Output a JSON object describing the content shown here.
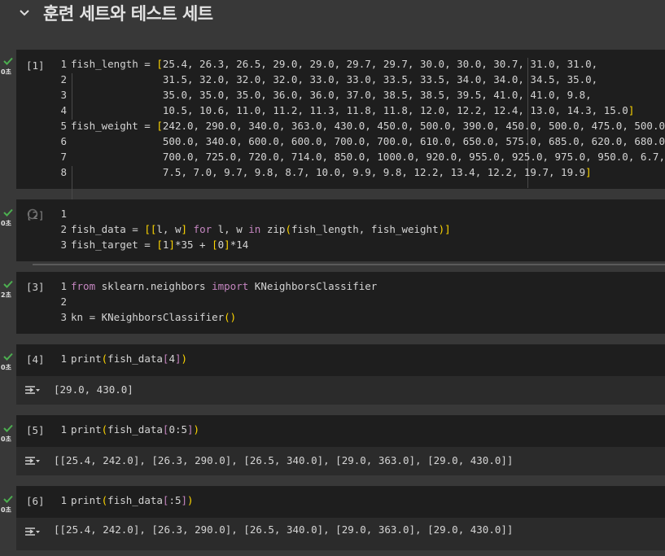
{
  "section": {
    "title": "훈련 세트와 테스트 세트"
  },
  "cells": [
    {
      "exec": "[1]",
      "time": "0초",
      "lines": [
        {
          "n": "1",
          "t": "fish_length = [25.4, 26.3, 26.5, 29.0, 29.0, 29.7, 29.7, 30.0, 30.0, 30.7, 31.0, 31.0,"
        },
        {
          "n": "2",
          "t": "               31.5, 32.0, 32.0, 32.0, 33.0, 33.0, 33.5, 33.5, 34.0, 34.0, 34.5, 35.0,"
        },
        {
          "n": "3",
          "t": "               35.0, 35.0, 35.0, 36.0, 36.0, 37.0, 38.5, 38.5, 39.5, 41.0, 41.0, 9.8,"
        },
        {
          "n": "4",
          "t": "               10.5, 10.6, 11.0, 11.2, 11.3, 11.8, 11.8, 12.0, 12.2, 12.4, 13.0, 14.3, 15.0]"
        },
        {
          "n": "5",
          "t": "fish_weight = [242.0, 290.0, 340.0, 363.0, 430.0, 450.0, 500.0, 390.0, 450.0, 500.0, 475.0, 500.0,"
        },
        {
          "n": "6",
          "t": "               500.0, 340.0, 600.0, 600.0, 700.0, 700.0, 610.0, 650.0, 575.0, 685.0, 620.0, 680.0,"
        },
        {
          "n": "7",
          "t": "               700.0, 725.0, 720.0, 714.0, 850.0, 1000.0, 920.0, 955.0, 925.0, 975.0, 950.0, 6.7,"
        },
        {
          "n": "8",
          "t": "               7.5, 7.0, 9.7, 9.8, 8.7, 10.0, 9.9, 9.8, 12.2, 13.4, 12.2, 19.7, 19.9]"
        }
      ]
    },
    {
      "exec": "[2]",
      "time": "0초",
      "lines": [
        {
          "n": "1",
          "t": ""
        },
        {
          "n": "2",
          "t": "fish_data = [[l, w] for l, w in zip(fish_length, fish_weight)]"
        },
        {
          "n": "3",
          "t": "fish_target = [1]*35 + [0]*14"
        }
      ]
    },
    {
      "exec": "[3]",
      "time": "2초",
      "lines": [
        {
          "n": "1",
          "t": "from sklearn.neighbors import KNeighborsClassifier"
        },
        {
          "n": "2",
          "t": ""
        },
        {
          "n": "3",
          "t": "kn = KNeighborsClassifier()"
        }
      ]
    },
    {
      "exec": "[4]",
      "time": "0초",
      "lines": [
        {
          "n": "1",
          "t": "print(fish_data[4])"
        }
      ],
      "output": "[29.0, 430.0]"
    },
    {
      "exec": "[5]",
      "time": "0초",
      "lines": [
        {
          "n": "1",
          "t": "print(fish_data[0:5])"
        }
      ],
      "output": "[[25.4, 242.0], [26.3, 290.0], [26.5, 340.0], [29.0, 363.0], [29.0, 430.0]]"
    },
    {
      "exec": "[6]",
      "time": "0초",
      "lines": [
        {
          "n": "1",
          "t": "print(fish_data[:5])"
        }
      ],
      "output": "[[25.4, 242.0], [26.3, 290.0], [26.5, 340.0], [29.0, 363.0], [29.0, 430.0]]"
    }
  ],
  "icons": {
    "section_toggle": "chevron-down-icon",
    "status": "check-icon",
    "output_toggle": "output-toggle-icon",
    "running": "spinner-icon"
  },
  "colors": {
    "check": "#4caf50",
    "keyword": "#c586c0",
    "bracket": "#ffd700"
  }
}
